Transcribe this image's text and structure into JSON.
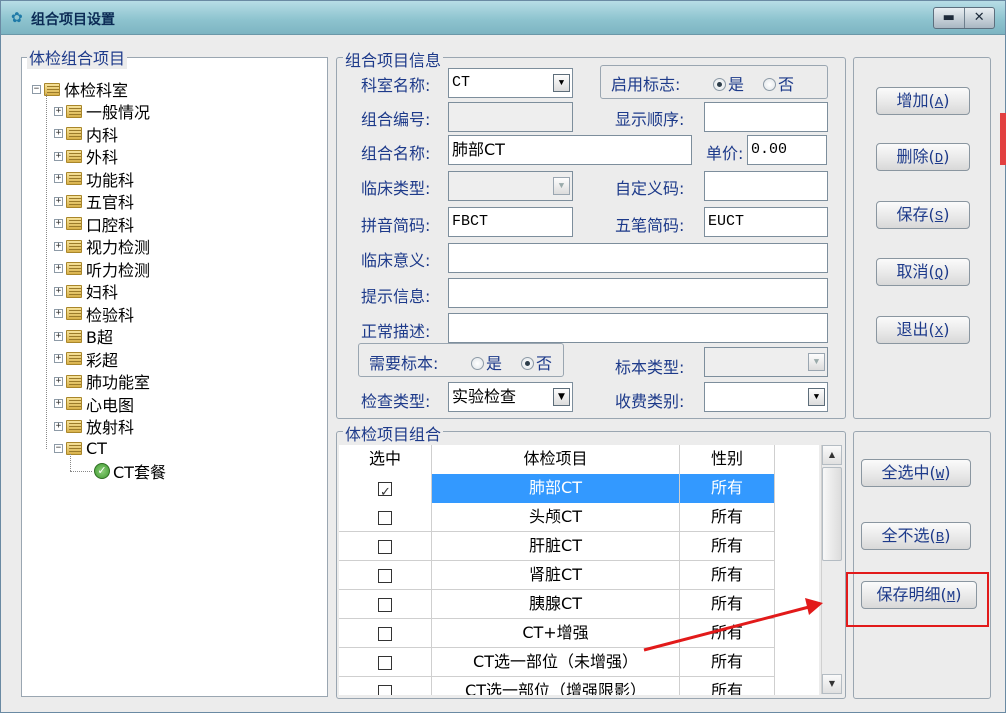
{
  "window": {
    "title": "组合项目设置",
    "minimize_glyph": "▬",
    "close_glyph": "✕"
  },
  "tree": {
    "group_title": "体检组合项目",
    "root": "体检科室",
    "items": [
      "一般情况",
      "内科",
      "外科",
      "功能科",
      "五官科",
      "口腔科",
      "视力检测",
      "听力检测",
      "妇科",
      "检验科",
      "B超",
      "彩超",
      "肺功能室",
      "心电图",
      "放射科",
      "CT"
    ],
    "child": "CT套餐",
    "expand_glyph": "+",
    "collapse_glyph": "−"
  },
  "info": {
    "group_title": "组合项目信息",
    "dept_label": "科室名称:",
    "dept_value": "CT",
    "enable_label": "启用标志:",
    "yes": "是",
    "no": "否",
    "code_label": "组合编号:",
    "code_value": "",
    "order_label": "显示顺序:",
    "order_value": "",
    "name_label": "组合名称:",
    "name_value": "肺部CT",
    "price_label": "单价:",
    "price_value": "0.00",
    "clinic_type_label": "临床类型:",
    "custom_code_label": "自定义码:",
    "pinyin_label": "拼音简码:",
    "pinyin_value": "FBCT",
    "wubi_label": "五笔简码:",
    "wubi_value": "EUCT",
    "meaning_label": "临床意义:",
    "hint_label": "提示信息:",
    "normal_label": "正常描述:",
    "need_sample_label": "需要标本:",
    "sample_type_label": "标本类型:",
    "check_type_label": "检查类型:",
    "check_type_value": "实验检查",
    "fee_type_label": "收费类别:",
    "dropdown_glyph": "▼"
  },
  "buttons": {
    "add": "增加",
    "add_key": "A",
    "delete": "删除",
    "delete_key": "D",
    "save": "保存",
    "save_key": "S",
    "cancel": "取消",
    "cancel_key": "Q",
    "exit": "退出",
    "exit_key": "X",
    "select_all": "全选中",
    "select_all_key": "W",
    "select_none": "全不选",
    "select_none_key": "B",
    "save_detail": "保存明细",
    "save_detail_key": "M"
  },
  "table": {
    "group_title": "体检项目组合",
    "columns": [
      "选中",
      "体检项目",
      "性别"
    ],
    "rows": [
      {
        "checked": true,
        "item": "肺部CT",
        "sex": "所有"
      },
      {
        "checked": false,
        "item": "头颅CT",
        "sex": "所有"
      },
      {
        "checked": false,
        "item": "肝脏CT",
        "sex": "所有"
      },
      {
        "checked": false,
        "item": "肾脏CT",
        "sex": "所有"
      },
      {
        "checked": false,
        "item": "胰腺CT",
        "sex": "所有"
      },
      {
        "checked": false,
        "item": "CT+增强",
        "sex": "所有"
      },
      {
        "checked": false,
        "item": "CT选一部位（未增强）",
        "sex": "所有"
      },
      {
        "checked": false,
        "item": "CT选一部位（增强限影）",
        "sex": "所有"
      }
    ],
    "scroll_up_glyph": "▲",
    "scroll_down_glyph": "▼"
  },
  "colors": {
    "selection": "#3399ff",
    "annotation": "#e21a1a",
    "label": "#1d3a8a"
  }
}
